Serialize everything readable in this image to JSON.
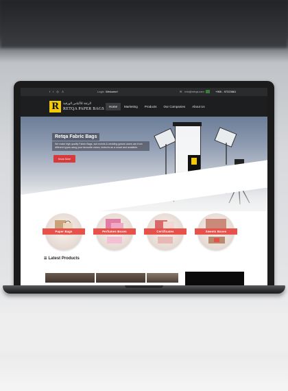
{
  "topbar": {
    "social_icons": [
      "facebook-icon",
      "twitter-icon",
      "instagram-icon",
      "user-icon"
    ],
    "login": "Login",
    "welcome": "Welcome!",
    "email": "info@retqa.com",
    "phone": "+965 - 97223661"
  },
  "brand": {
    "name_ar": "الرتقة للأكياس الورقية",
    "name_en": "RETQA PAPER BAGS",
    "logo_letter": "R",
    "logo_color": "#f2cb06"
  },
  "nav": {
    "items": [
      "Home",
      "Marketing",
      "Products",
      "Our Companies",
      "About Us"
    ],
    "active": "Home"
  },
  "hero": {
    "title": "Retqa Fabric Bags",
    "description": "We make high quality Fabric Bags, suit events & wedding gowns users can from different types using your favourite colors, textures as a smart and available.",
    "button": "Know More",
    "button_color": "#d63a3a"
  },
  "categories": [
    {
      "label": "Paper Bags"
    },
    {
      "label": "Perfumes Boxes"
    },
    {
      "label": "Certificates"
    },
    {
      "label": "Sweets Boxes"
    }
  ],
  "ribbon_color": "#e6524a",
  "latest": {
    "title": "Latest Products"
  }
}
